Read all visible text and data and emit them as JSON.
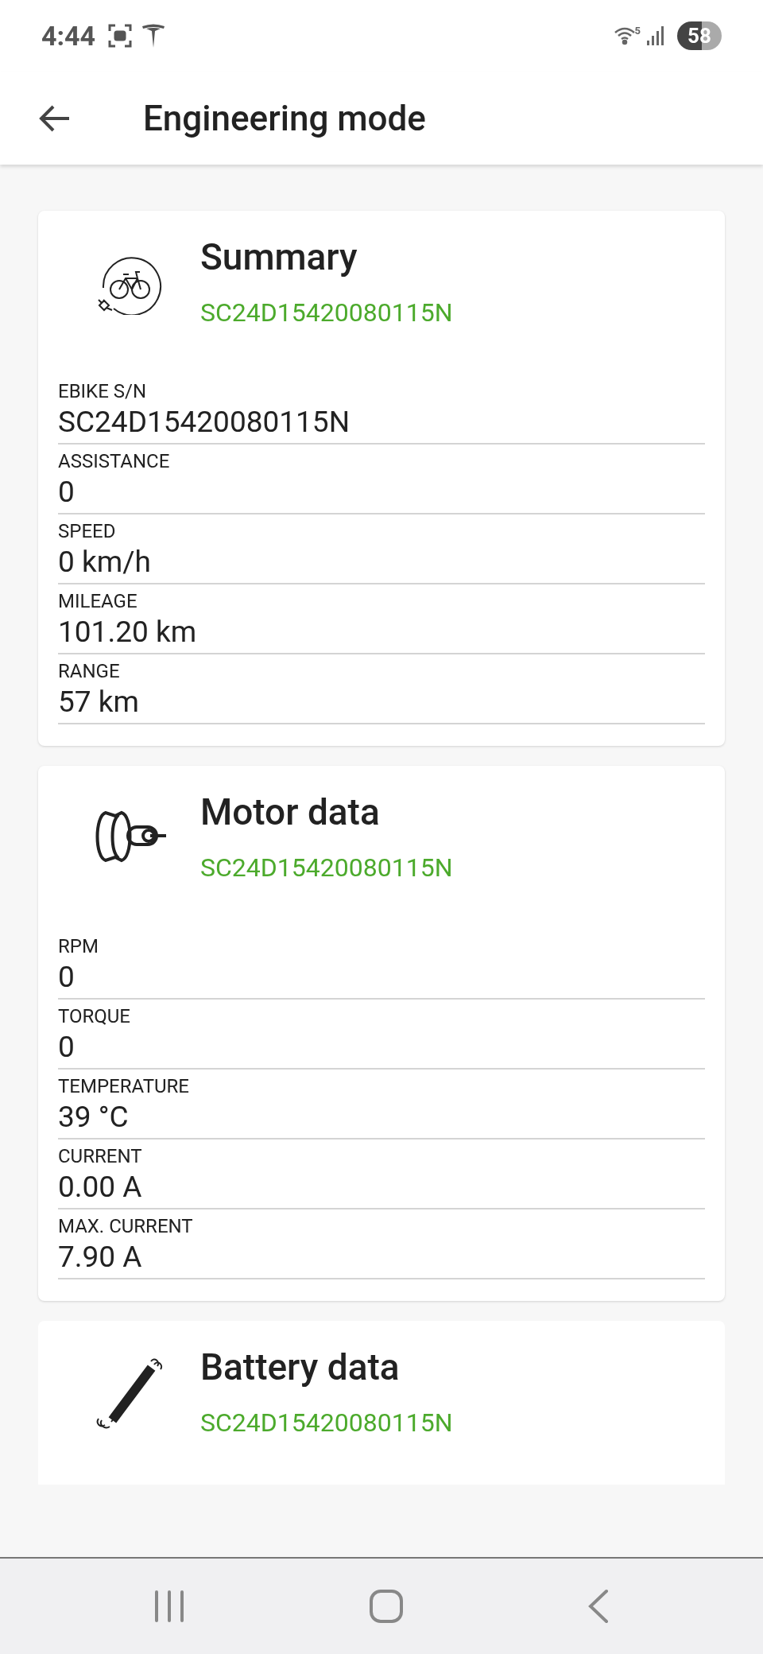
{
  "status_bar": {
    "time": "4:44",
    "wifi_badge": "5",
    "battery": "58"
  },
  "app_bar": {
    "title": "Engineering mode"
  },
  "cards": [
    {
      "kind": "bike",
      "title": "Summary",
      "subtitle": "SC24D15420080115N",
      "fields": [
        {
          "label": "EBIKE S/N",
          "value": "SC24D15420080115N"
        },
        {
          "label": "ASSISTANCE",
          "value": "0"
        },
        {
          "label": "SPEED",
          "value": "0 km/h"
        },
        {
          "label": "MILEAGE",
          "value": "101.20 km"
        },
        {
          "label": "RANGE",
          "value": "57 km"
        }
      ]
    },
    {
      "kind": "motor",
      "title": "Motor data",
      "subtitle": "SC24D15420080115N",
      "fields": [
        {
          "label": "RPM",
          "value": "0"
        },
        {
          "label": "TORQUE",
          "value": "0"
        },
        {
          "label": "TEMPERATURE",
          "value": "39 °C"
        },
        {
          "label": "CURRENT",
          "value": "0.00 A"
        },
        {
          "label": "MAX. CURRENT",
          "value": "7.90 A"
        }
      ]
    },
    {
      "kind": "battery",
      "title": "Battery data",
      "subtitle": "SC24D15420080115N"
    }
  ]
}
